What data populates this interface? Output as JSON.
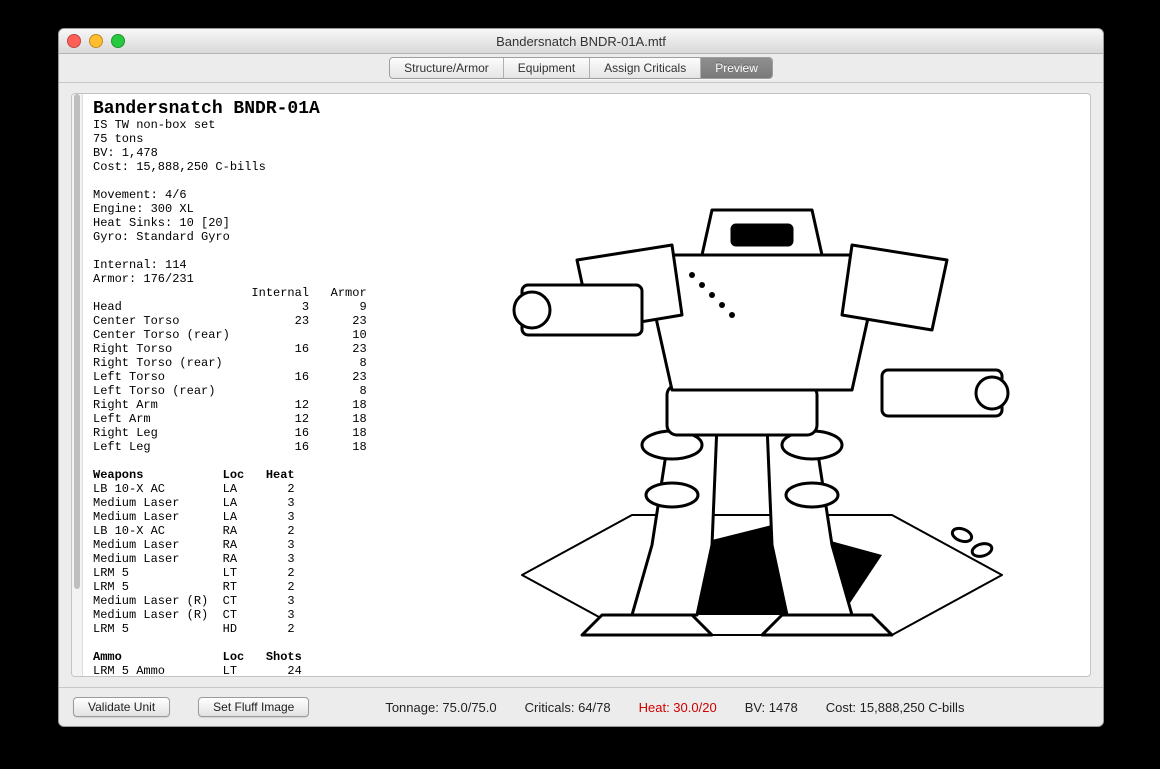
{
  "window": {
    "title": "Bandersnatch BNDR-01A.mtf"
  },
  "tabs": [
    {
      "label": "Structure/Armor",
      "active": false
    },
    {
      "label": "Equipment",
      "active": false
    },
    {
      "label": "Assign Criticals",
      "active": false
    },
    {
      "label": "Preview",
      "active": true
    }
  ],
  "unit": {
    "name": "Bandersnatch BNDR-01A",
    "ruleset": "IS TW non-box set",
    "tonnage_line": "75 tons",
    "bv_line": "BV: 1,478",
    "cost_line": "Cost: 15,888,250 C-bills",
    "movement": "Movement: 4/6",
    "engine": "Engine: 300 XL",
    "heat_sinks": "Heat Sinks: 10 [20]",
    "gyro": "Gyro: Standard Gyro",
    "internal_total": "Internal: 114",
    "armor_total": "Armor: 176/231"
  },
  "locations_header": {
    "col_internal": "Internal",
    "col_armor": "Armor"
  },
  "locations": [
    {
      "name": "Head",
      "internal": "3",
      "armor": "9"
    },
    {
      "name": "Center Torso",
      "internal": "23",
      "armor": "23"
    },
    {
      "name": "Center Torso (rear)",
      "internal": "",
      "armor": "10"
    },
    {
      "name": "Right Torso",
      "internal": "16",
      "armor": "23"
    },
    {
      "name": "Right Torso (rear)",
      "internal": "",
      "armor": "8"
    },
    {
      "name": "Left Torso",
      "internal": "16",
      "armor": "23"
    },
    {
      "name": "Left Torso (rear)",
      "internal": "",
      "armor": "8"
    },
    {
      "name": "Right Arm",
      "internal": "12",
      "armor": "18"
    },
    {
      "name": "Left Arm",
      "internal": "12",
      "armor": "18"
    },
    {
      "name": "Right Leg",
      "internal": "16",
      "armor": "18"
    },
    {
      "name": "Left Leg",
      "internal": "16",
      "armor": "18"
    }
  ],
  "weapons_header": {
    "title": "Weapons",
    "loc": "Loc",
    "heat": "Heat"
  },
  "weapons": [
    {
      "name": "LB 10-X AC",
      "loc": "LA",
      "heat": "2"
    },
    {
      "name": "Medium Laser",
      "loc": "LA",
      "heat": "3"
    },
    {
      "name": "Medium Laser",
      "loc": "LA",
      "heat": "3"
    },
    {
      "name": "LB 10-X AC",
      "loc": "RA",
      "heat": "2"
    },
    {
      "name": "Medium Laser",
      "loc": "RA",
      "heat": "3"
    },
    {
      "name": "Medium Laser",
      "loc": "RA",
      "heat": "3"
    },
    {
      "name": "LRM 5",
      "loc": "LT",
      "heat": "2"
    },
    {
      "name": "LRM 5",
      "loc": "RT",
      "heat": "2"
    },
    {
      "name": "Medium Laser (R)",
      "loc": "CT",
      "heat": "3"
    },
    {
      "name": "Medium Laser (R)",
      "loc": "CT",
      "heat": "3"
    },
    {
      "name": "LRM 5",
      "loc": "HD",
      "heat": "2"
    }
  ],
  "ammo_header": {
    "title": "Ammo",
    "loc": "Loc",
    "shots": "Shots"
  },
  "ammo": [
    {
      "name": "LRM 5 Ammo",
      "loc": "LT",
      "shots": "24"
    }
  ],
  "footer": {
    "validate": "Validate Unit",
    "set_fluff": "Set Fluff Image",
    "tonnage": "Tonnage: 75.0/75.0",
    "criticals": "Criticals: 64/78",
    "heat": "Heat: 30.0/20",
    "bv": "BV: 1478",
    "cost": "Cost: 15,888,250 C-bills"
  }
}
